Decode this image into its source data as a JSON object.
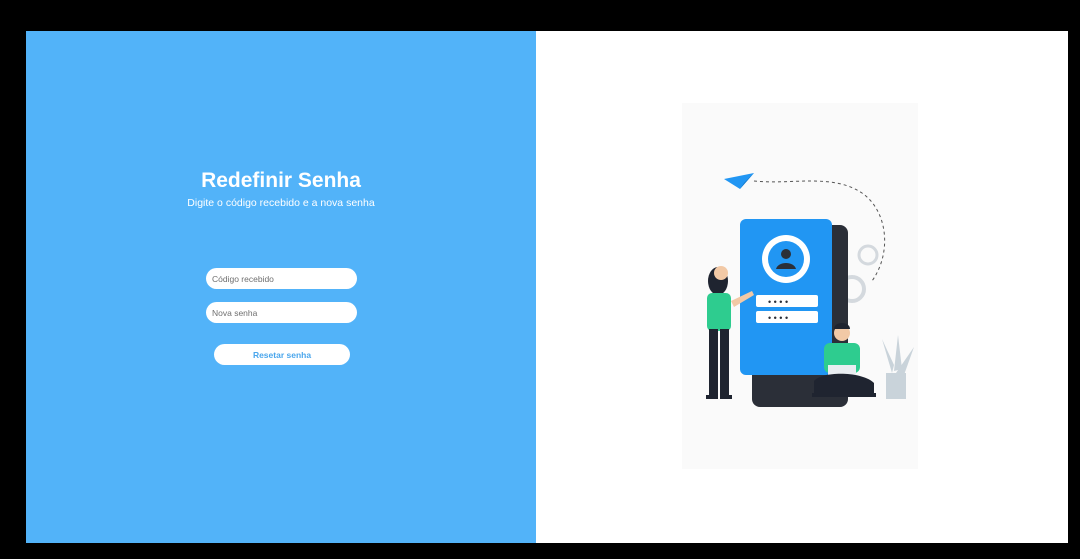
{
  "reset_form": {
    "title": "Redefinir Senha",
    "subtitle": "Digite o código recebido e a nova senha",
    "code_placeholder": "Código recebido",
    "password_placeholder": "Nova senha",
    "reset_button_label": "Resetar senha"
  },
  "illustration": {
    "password_mask_1": "• • • •",
    "password_mask_2": "• • • •"
  },
  "colors": {
    "left_panel": "#52b3f9",
    "button_text": "#4aa6ec",
    "phone": "#2196f3",
    "person_shirt": "#2ecc8f"
  }
}
